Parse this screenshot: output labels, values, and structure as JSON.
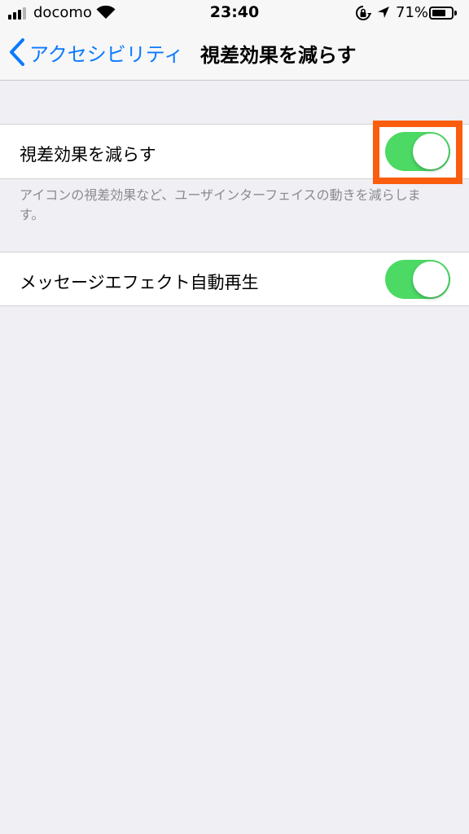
{
  "status_bar": {
    "carrier": "docomo",
    "time": "23:40",
    "battery_percent_label": "71%",
    "battery_level": 0.71,
    "signal_bars": 3,
    "icons": [
      "signal-icon",
      "wifi-icon",
      "rotation-lock-icon",
      "location-icon",
      "battery-icon"
    ]
  },
  "nav": {
    "back_label": "アクセシビリティ",
    "title": "視差効果を減らす"
  },
  "settings": {
    "reduce_motion": {
      "label": "視差効果を減らす",
      "enabled": true,
      "footnote": "アイコンの視差効果など、ユーザインターフェイスの動きを減らします。"
    },
    "message_effects": {
      "label": "メッセージエフェクト自動再生",
      "enabled": true
    }
  },
  "colors": {
    "accent": "#0a7aff",
    "toggle_on": "#4cd964",
    "highlight_box": "#fb5d0e",
    "background": "#efeff4"
  }
}
